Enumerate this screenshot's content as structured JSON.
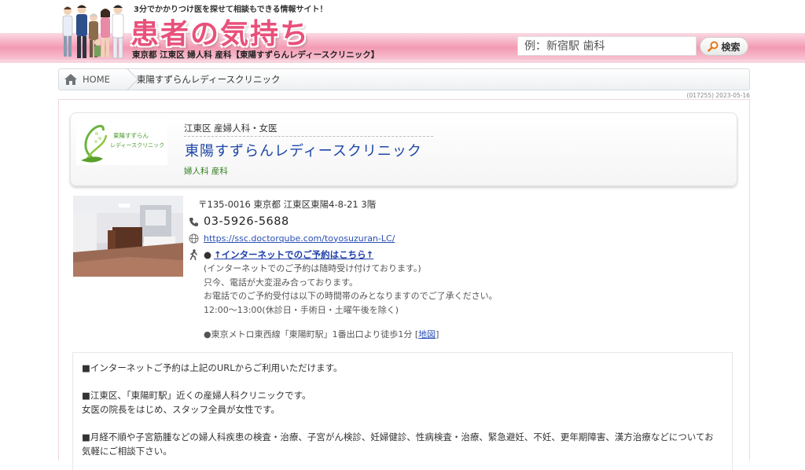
{
  "header": {
    "tagline": "3分でかかりつけ医を探せて相談もできる情報サイト！",
    "site_title": "患者の気持ち",
    "location_line": "東京都 江東区 婦人科 産科【東陽すずらんレディースクリニック】",
    "search_placeholder": "例：新宿駅 歯科",
    "search_button": "検索"
  },
  "breadcrumb": {
    "home": "HOME",
    "current": "東陽すずらんレディースクリニック"
  },
  "meta": {
    "id_date": "(017255) 2023-05-16"
  },
  "clinic": {
    "logo_line1": "東陽すずらん",
    "logo_line2": "レディースクリニック",
    "district": "江東区 産婦人科・女医",
    "name": "東陽すずらんレディースクリニック",
    "specialties": "婦人科 産科",
    "address": "〒135-0016 東京都 江東区東陽4-8-21 3階",
    "phone": "03-5926-5688",
    "url": "https://ssc.doctorqube.com/toyosuzuran-LC/",
    "reserve_link": "↑インターネットでのご予約はこちら↑",
    "notes": [
      "(インターネットでのご予約は随時受け付けております。)",
      "只今、電話が大変混み合っております。",
      "お電話でのご予約受付は以下の時間帯のみとなりますのでご了承ください。",
      "12:00～13:00(休診日・手術日・土曜午後を除く)"
    ],
    "access": "●東京メトロ東西線「東陽町駅」1番出口より徒歩1分",
    "map_link": "地図"
  },
  "description": [
    "■インターネットご予約は上記のURLからご利用いただけます。",
    "■江東区、「東陽町駅」近くの産婦人科クリニックです。",
    "女医の院長をはじめ、スタッフ全員が女性です。",
    "■月経不順や子宮筋腫などの婦人科疾患の検査・治療、子宮がん検診、妊婦健診、性病検査・治療、緊急避妊、不妊、更年期障害、漢方治療などについてお",
    "気軽にご相談下さい。"
  ]
}
